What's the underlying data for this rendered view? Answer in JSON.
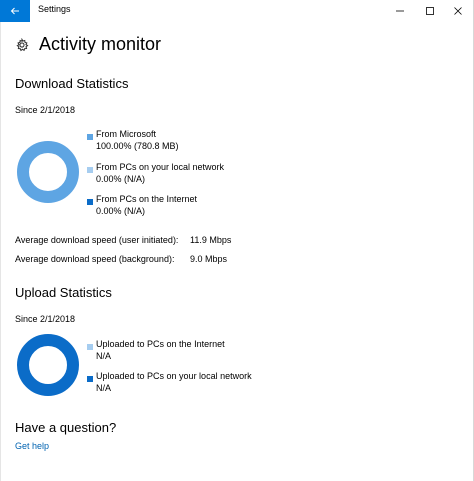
{
  "window": {
    "title": "Settings"
  },
  "page": {
    "title": "Activity monitor",
    "icon": "gear-icon"
  },
  "download": {
    "title": "Download Statistics",
    "since": "Since 2/1/2018",
    "legend": [
      {
        "label": "From Microsoft",
        "value": "100.00%  (780.8 MB)",
        "color": "#5ea5e3",
        "percent": 100
      },
      {
        "label": "From PCs on your local network",
        "value": "0.00%  (N/A)",
        "color": "#a6cdf0",
        "percent": 0
      },
      {
        "label": "From PCs on the Internet",
        "value": "0.00%  (N/A)",
        "color": "#0b6cc8",
        "percent": 0
      }
    ],
    "speeds": [
      {
        "label": "Average download speed (user initiated):",
        "value": "11.9 Mbps"
      },
      {
        "label": "Average download speed (background):",
        "value": "9.0 Mbps"
      }
    ]
  },
  "upload": {
    "title": "Upload Statistics",
    "since": "Since 2/1/2018",
    "ring_color": "#0b6cc8",
    "legend": [
      {
        "label": "Uploaded to PCs on the Internet",
        "value": "N/A",
        "color": "#a6cdf0"
      },
      {
        "label": "Uploaded to PCs on your local network",
        "value": "N/A",
        "color": "#0b6cc8"
      }
    ]
  },
  "help": {
    "title": "Have a question?",
    "link": "Get help"
  },
  "colors": {
    "accent": "#0078d7",
    "link": "#0063b1"
  }
}
